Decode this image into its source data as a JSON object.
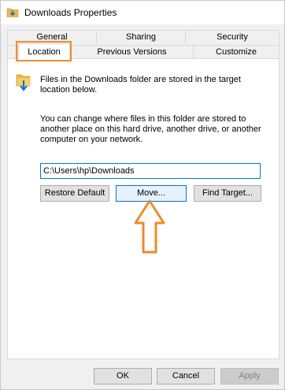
{
  "window": {
    "title": "Downloads Properties"
  },
  "tabs": {
    "row1": [
      {
        "label": "General"
      },
      {
        "label": "Sharing"
      },
      {
        "label": "Security"
      }
    ],
    "row2": [
      {
        "label": "Location",
        "active": true
      },
      {
        "label": "Previous Versions"
      },
      {
        "label": "Customize"
      }
    ]
  },
  "location": {
    "description": "Files in the Downloads folder are stored in the target location below.",
    "info_line1": "You can change where files in this folder are stored to",
    "info_line2": "another place on this hard drive, another drive, or another",
    "info_line3": "computer on your network.",
    "desc_line1": "Files in the Downloads folder are stored in the target",
    "desc_line2": "location below.",
    "path": "C:\\Users\\hp\\Downloads",
    "restore_default": "Restore Default",
    "move": "Move...",
    "find_target": "Find Target..."
  },
  "footer": {
    "ok": "OK",
    "cancel": "Cancel",
    "apply": "Apply"
  },
  "colors": {
    "annotation": "#f08a2c",
    "focus": "#0078d7",
    "folder": "#e8b84a"
  },
  "icons": {
    "title": "folder-download-icon",
    "panel": "folder-download-icon",
    "annotation_arrow": "up-arrow-icon"
  }
}
